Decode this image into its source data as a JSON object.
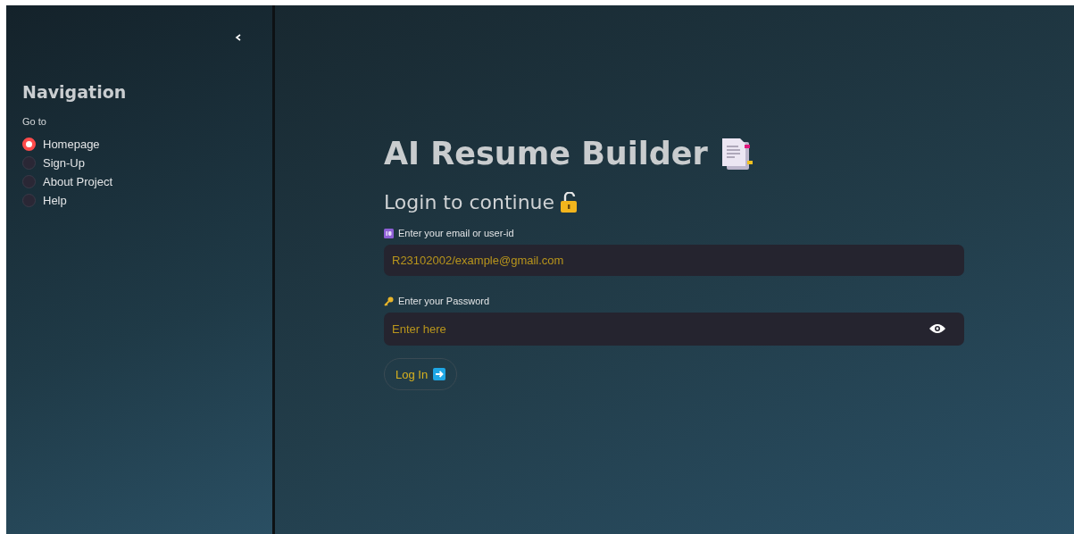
{
  "sidebar": {
    "heading": "Navigation",
    "group_label": "Go to",
    "items": [
      {
        "label": "Homepage",
        "selected": true
      },
      {
        "label": "Sign-Up",
        "selected": false
      },
      {
        "label": "About Project",
        "selected": false
      },
      {
        "label": "Help",
        "selected": false
      }
    ]
  },
  "main": {
    "title": "AI Resume Builder",
    "subtitle": "Login to continue",
    "fields": [
      {
        "kind": "text",
        "label": "Enter your email or user-id",
        "placeholder": "R23102002/example@gmail.com"
      },
      {
        "kind": "password",
        "label": "Enter your Password",
        "placeholder": "Enter here"
      }
    ],
    "button": "Log In"
  }
}
